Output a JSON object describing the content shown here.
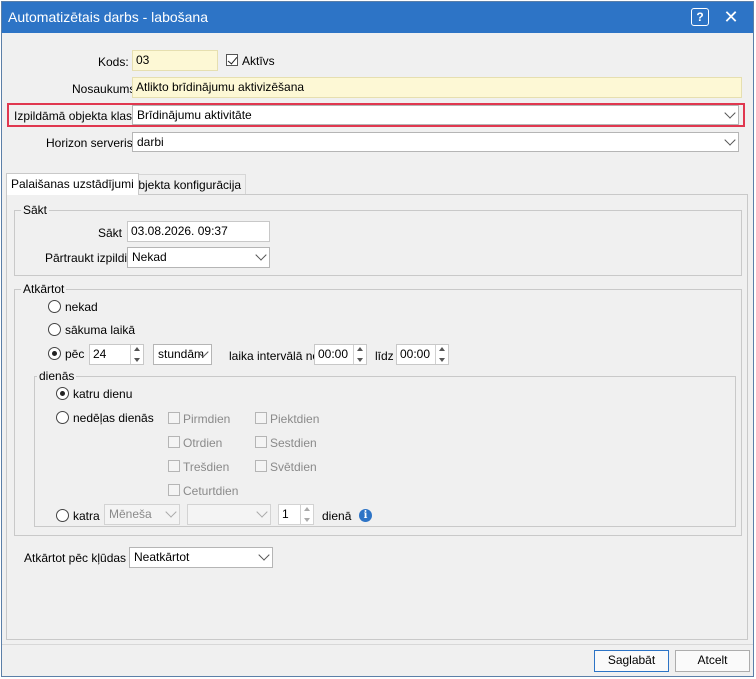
{
  "window": {
    "title": "Automatizētais darbs - labošana",
    "help_glyph": "?",
    "close_glyph": "✕"
  },
  "form": {
    "kods_label": "Kods:",
    "kods_value": "03",
    "aktivs_label": "Aktīvs",
    "aktivs_checked": true,
    "nosaukums_label": "Nosaukums:",
    "nosaukums_value": "Atlikto brīdinājumu aktivizēšana",
    "klase_label": "Izpildāmā objekta klase:",
    "klase_value": "Brīdinājumu aktivitāte",
    "server_label": "Horizon serveris:",
    "server_value": "darbi",
    "highlight_color": "#e0374f"
  },
  "tabs": [
    {
      "label": "Palaišanas uzstādījumi",
      "active": true
    },
    {
      "label": "Objekta konfigurācija",
      "active": false
    }
  ],
  "sakt_group": {
    "title": "Sākt",
    "sakt_label": "Sākt",
    "sakt_value": "03.08.2026. 09:37",
    "partraukt_label": "Pārtraukt izpildi",
    "partraukt_value": "Nekad"
  },
  "atkartot": {
    "title": "Atkārtot",
    "nekad": "nekad",
    "sakuma": "sākuma laikā",
    "pec": "pēc",
    "pec_value": "24",
    "pec_unit": "stundām",
    "interval_label": "laika intervālā no",
    "from_value": "00:00",
    "lidz_label": "līdz",
    "to_value": "00:00",
    "selected": "pec",
    "dienas": {
      "title": "dienās",
      "katru": "katru dienu",
      "nedelas": "nedēļas dienās",
      "days": [
        "Pirmdien",
        "Otrdien",
        "Trešdien",
        "Ceturtdien",
        "Piektdien",
        "Sestdien",
        "Svētdien"
      ],
      "katra": "katra",
      "katra_period": "Mēneša",
      "katra_day_value": "",
      "katra_num": "1",
      "diena": "dienā",
      "selected": "katru"
    }
  },
  "after_error": {
    "label": "Atkārtot pēc kļūdas",
    "value": "Neatkārtot"
  },
  "buttons": {
    "save": "Saglabāt",
    "cancel": "Atcelt"
  }
}
